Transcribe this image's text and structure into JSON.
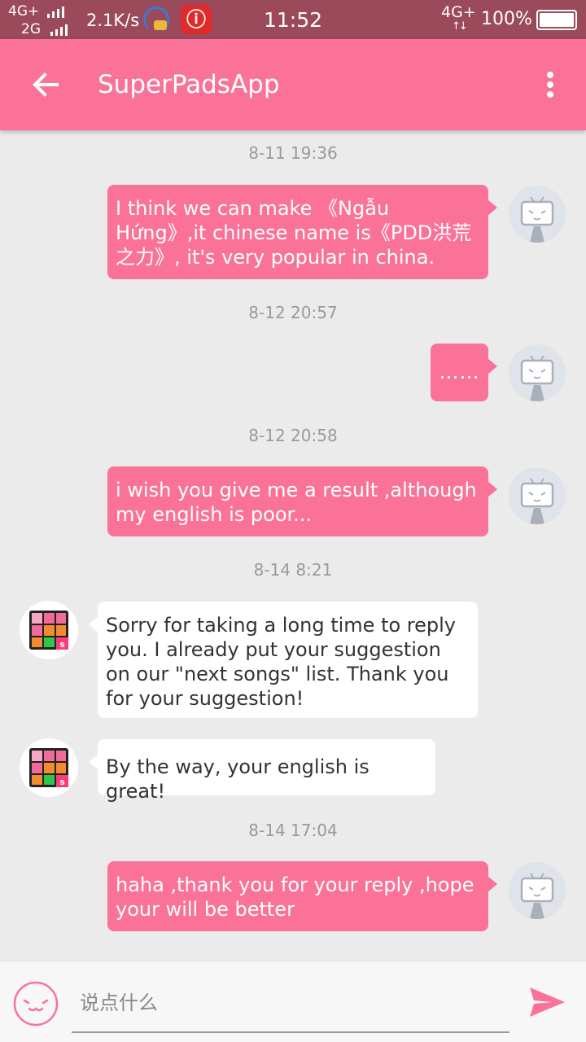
{
  "status_bar": {
    "network_1": "4G+",
    "network_2": "2G",
    "speed": "2.1K/s",
    "time": "11:52",
    "network_right": "4G+",
    "network_right_arrows": "↑↓",
    "battery": "100%",
    "app_icons": [
      "headset-chat-icon",
      "netease-music-icon"
    ]
  },
  "app_bar": {
    "title": "SuperPadsApp",
    "back_icon": "arrow-left-icon",
    "menu_icon": "more-vertical-icon"
  },
  "messages": [
    {
      "timestamp": "8-11 19:36",
      "sender": "me",
      "text": " I think we can make 《Ngẫu Hứng》,it chinese name is《PDD洪荒之力》,  it's very popular in china."
    },
    {
      "timestamp": "8-12 20:57",
      "sender": "me",
      "text": "……"
    },
    {
      "timestamp": "8-12 20:58",
      "sender": "me",
      "text": "i wish you give me a result ,although my english is poor..."
    },
    {
      "timestamp": "8-14 8:21",
      "sender": "app",
      "text": "Sorry for taking a long time to reply you. I already put your suggestion on our \"next songs\" list. Thank you for your suggestion!"
    },
    {
      "timestamp": "",
      "sender": "app",
      "text": "By the way, your english is great!"
    },
    {
      "timestamp": "8-14 17:04",
      "sender": "me",
      "text": " haha ,thank you for your reply ,hope your will be better"
    }
  ],
  "input": {
    "placeholder": "说点什么",
    "value": ""
  },
  "colors": {
    "accent": "#fb7299",
    "status_bar": "#9b4a5c",
    "background": "#ebebeb"
  }
}
